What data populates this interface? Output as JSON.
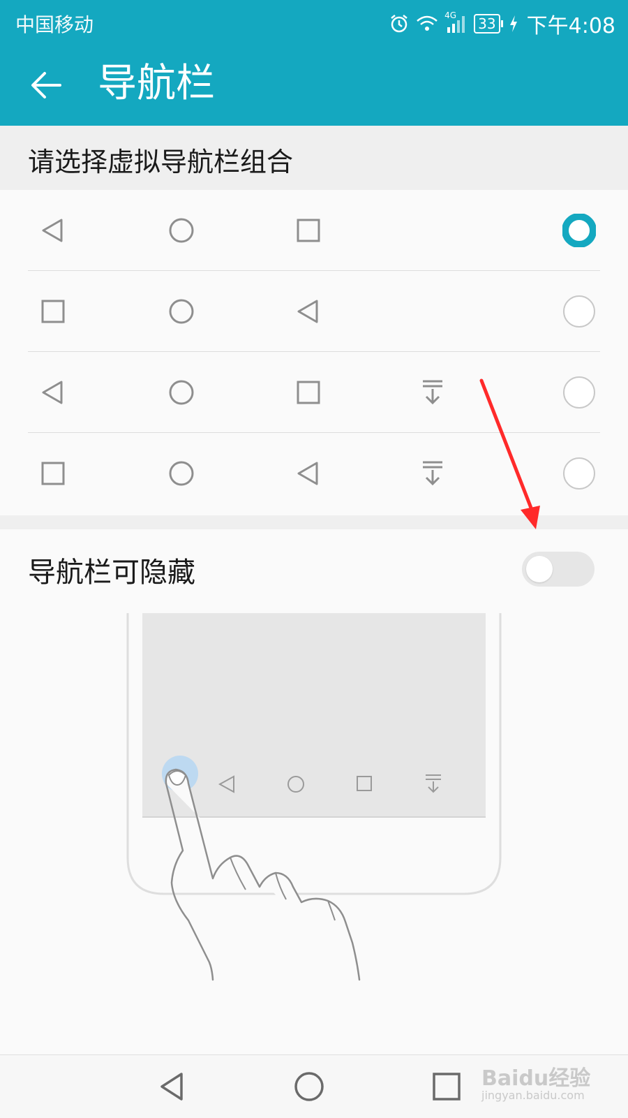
{
  "status_bar": {
    "carrier": "中国移动",
    "network": "4G",
    "battery": "33",
    "time": "下午4:08",
    "icons": [
      "alarm-icon",
      "wifi-icon",
      "signal-icon",
      "battery-icon",
      "charging-icon"
    ]
  },
  "app_bar": {
    "title": "导航栏",
    "back_icon": "arrow-left-icon"
  },
  "section": {
    "title": "请选择虚拟导航栏组合"
  },
  "options": [
    {
      "icons": [
        "back",
        "home",
        "recent"
      ],
      "selected": true
    },
    {
      "icons": [
        "recent",
        "home",
        "back"
      ],
      "selected": false
    },
    {
      "icons": [
        "back",
        "home",
        "recent",
        "hide-nav"
      ],
      "selected": false
    },
    {
      "icons": [
        "recent",
        "home",
        "back",
        "hide-nav"
      ],
      "selected": false
    }
  ],
  "toggle": {
    "label": "导航栏可隐藏",
    "checked": false
  },
  "system_nav": {
    "icons": [
      "back-icon",
      "home-icon",
      "recent-apps-icon"
    ]
  },
  "watermark": {
    "text": "Baidu经验",
    "url_text": "jingyan.baidu.com"
  },
  "colors": {
    "accent": "#14a8c0",
    "annotation_arrow": "#ff2a2a"
  }
}
